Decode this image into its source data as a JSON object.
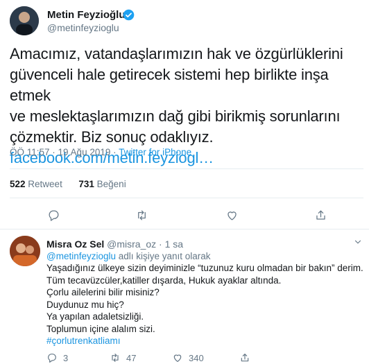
{
  "author": {
    "name": "Metin Feyzioğlu",
    "handle": "@metinfeyzioglu"
  },
  "tweet": {
    "lines": [
      "Amacımız, vatandaşlarımızın hak ve özgürlüklerini",
      "güvenceli hale getirecek sistemi hep birlikte inşa etmek",
      "ve meslektaşlarımızın dağ gibi birikmiş sorunlarını",
      "çözmektir. Biz sonuç odaklıyız."
    ],
    "link": "facebook.com/metin.feyziogl…",
    "time": "ÖÖ 11:57 · 19 Ağu 2019 · ",
    "source": "Twitter for iPhone"
  },
  "stats": {
    "retweets_count": "522",
    "retweets_label": "Retweet",
    "likes_count": "731",
    "likes_label": "Beğeni"
  },
  "reply": {
    "name": "Misra Oz Sel",
    "meta": "@misra_oz · 1 sa",
    "reply_to_handle": "@metinfeyzioglu",
    "reply_to_suffix": " adlı kişiye yanıt olarak",
    "lines": [
      "Yaşadığınız ülkeye sizin deyiminizle “tuzunuz kuru olmadan bir bakın” derim.",
      "Tüm tecavüzcüler,katiller dışarda, Hukuk ayaklar altında.",
      "Çorlu ailelerini bilir misiniz?",
      "Duydunuz mu hiç?",
      "Ya yapılan adaletsizliği.",
      "Toplumun içine alalım sizi."
    ],
    "hashtag": "#çorlutrenkatliamı",
    "reply_count": "3",
    "retweet_count": "47",
    "like_count": "340"
  }
}
